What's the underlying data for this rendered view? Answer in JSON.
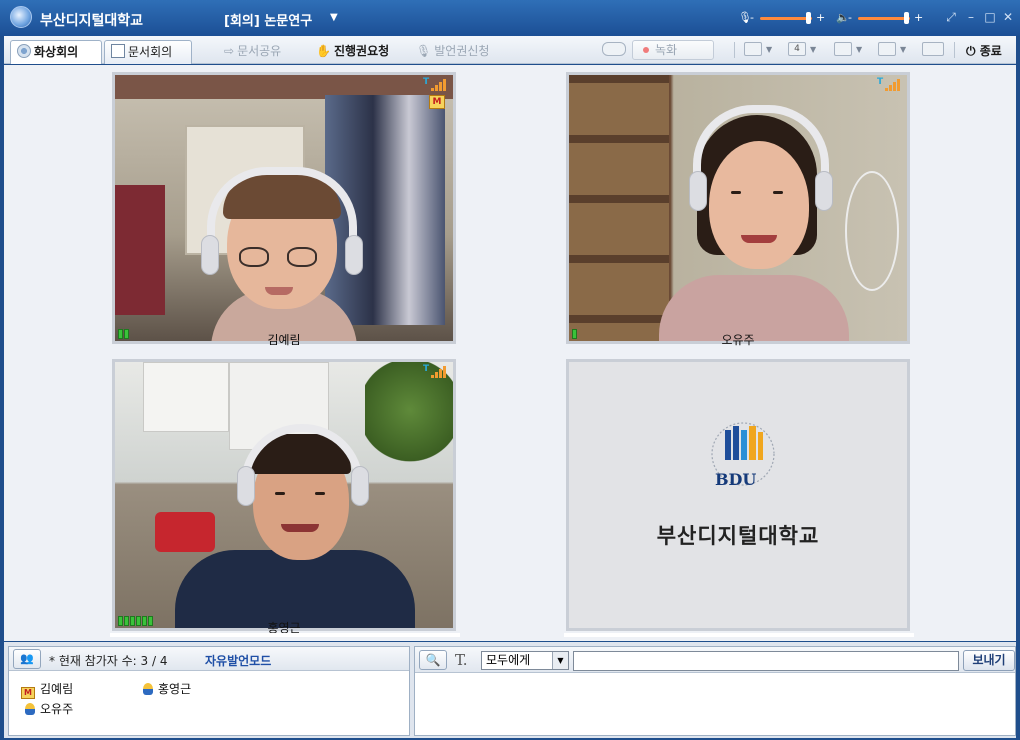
{
  "window": {
    "app_title": "부산디지털대학교",
    "meeting_title": "[회의] 논문연구",
    "window_controls": [
      "fullscreen-icon",
      "minimize-icon",
      "restore-icon",
      "close-icon"
    ]
  },
  "toolbar": {
    "tabs": [
      {
        "label": "화상회의",
        "active": true,
        "icon": "webcam-icon"
      },
      {
        "label": "문서회의",
        "active": false,
        "icon": "document-edit-icon"
      }
    ],
    "doc_share": "문서공유",
    "request_control": "진행권요청",
    "request_speak": "발언권신청",
    "record": "녹화",
    "layout_count": "4",
    "exit": "종료"
  },
  "videos": [
    {
      "name": "김예림",
      "is_host": true,
      "level_bars": 2
    },
    {
      "name": "오유주",
      "is_host": false,
      "level_bars": 1
    },
    {
      "name": "홍영근",
      "is_host": false,
      "level_bars": 6
    }
  ],
  "logo_tile": {
    "logo_text": "BDU",
    "school_name": "부산디지털대학교"
  },
  "participants_panel": {
    "count_label": "* 현재 참가자 수: 3 / 4",
    "mode_label": "자유발언모드",
    "participants": [
      {
        "name": "김예림",
        "role": "host"
      },
      {
        "name": "홍영근",
        "role": "user"
      },
      {
        "name": "오유주",
        "role": "user"
      }
    ]
  },
  "chat_panel": {
    "recipient": "모두에게",
    "message_value": "",
    "send_label": "보내기"
  },
  "colors": {
    "titlebar": "#1c4f95",
    "volume_bar": "#ff8a3c",
    "signal": "#f29b30",
    "level": "#3ac23a",
    "mode_text": "#1f4fa6"
  }
}
